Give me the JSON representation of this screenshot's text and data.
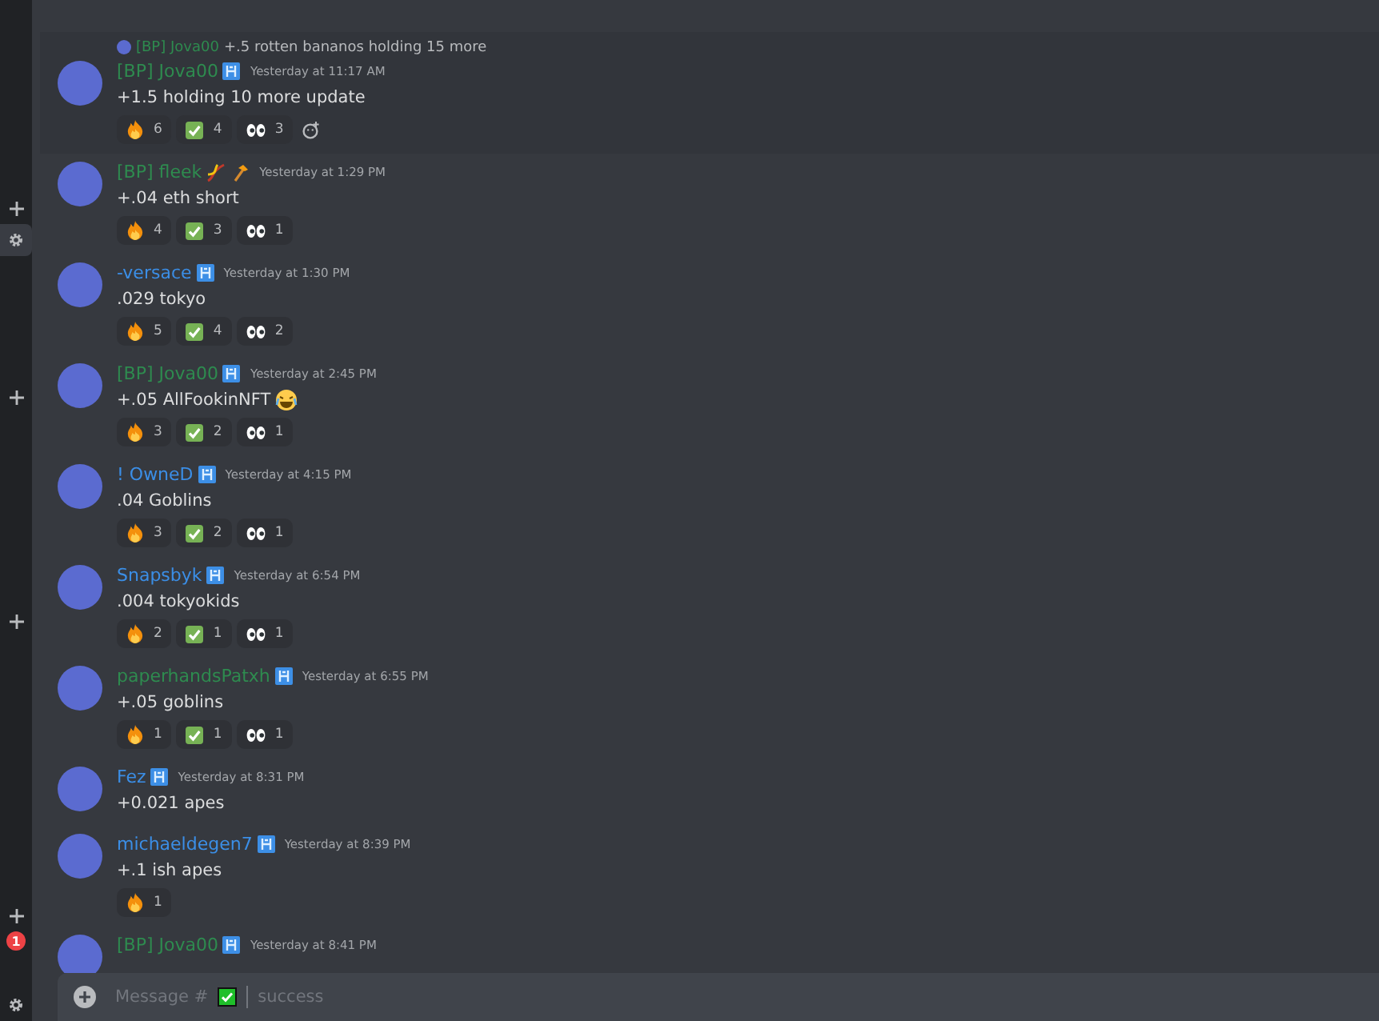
{
  "sidebar": {
    "items": [
      {
        "kind": "plus"
      },
      {
        "kind": "gear",
        "selected": true
      },
      {
        "kind": "plus"
      },
      {
        "kind": "plus"
      },
      {
        "kind": "plus"
      },
      {
        "kind": "badge",
        "count": "1"
      },
      {
        "kind": "gear",
        "selected": false
      }
    ]
  },
  "messages": [
    {
      "hovered": true,
      "reply": {
        "author": "[BP] Jova00",
        "color": "#2e8b4f",
        "text": "+.5 rotten bananos holding 15 more"
      },
      "author": "[BP] Jova00",
      "color": "#2e8b4f",
      "role_badge": true,
      "time": "Yesterday at 11:17 AM",
      "text": "+1.5 holding 10 more update",
      "reactions": [
        {
          "kind": "fire",
          "count": "6"
        },
        {
          "kind": "check",
          "count": "4"
        },
        {
          "kind": "eyes",
          "count": "3"
        }
      ]
    },
    {
      "hovered": false,
      "author": "[BP] fleek",
      "color": "#2e8b4f",
      "role_badge": false,
      "name_emojis": true,
      "time": "Yesterday at 1:29 PM",
      "text": "+.04 eth short",
      "reactions": [
        {
          "kind": "fire",
          "count": "4"
        },
        {
          "kind": "check",
          "count": "3"
        },
        {
          "kind": "eyes",
          "count": "1"
        }
      ]
    },
    {
      "hovered": false,
      "author": "-versace",
      "color": "#3b8ee6",
      "role_badge": true,
      "time": "Yesterday at 1:30 PM",
      "text": ".029 tokyo",
      "reactions": [
        {
          "kind": "fire",
          "count": "5"
        },
        {
          "kind": "check",
          "count": "4"
        },
        {
          "kind": "eyes",
          "count": "2"
        }
      ]
    },
    {
      "hovered": false,
      "author": "[BP] Jova00",
      "color": "#2e8b4f",
      "role_badge": true,
      "time": "Yesterday at 2:45 PM",
      "text": "+.05 AllFookinNFT",
      "text_emoji": true,
      "reactions": [
        {
          "kind": "fire",
          "count": "3"
        },
        {
          "kind": "check",
          "count": "2"
        },
        {
          "kind": "eyes",
          "count": "1"
        }
      ]
    },
    {
      "hovered": false,
      "author": "! OwneD",
      "color": "#3b8ee6",
      "role_badge": true,
      "time": "Yesterday at 4:15 PM",
      "text": ".04 Goblins",
      "reactions": [
        {
          "kind": "fire",
          "count": "3"
        },
        {
          "kind": "check",
          "count": "2"
        },
        {
          "kind": "eyes",
          "count": "1"
        }
      ]
    },
    {
      "hovered": false,
      "author": "Snapsbyk",
      "color": "#3b8ee6",
      "role_badge": true,
      "time": "Yesterday at 6:54 PM",
      "text": ".004 tokyokids",
      "reactions": [
        {
          "kind": "fire",
          "count": "2"
        },
        {
          "kind": "check",
          "count": "1"
        },
        {
          "kind": "eyes",
          "count": "1"
        }
      ]
    },
    {
      "hovered": false,
      "author": "paperhandsPatxh",
      "color": "#2e8b4f",
      "role_badge": true,
      "time": "Yesterday at 6:55 PM",
      "text": "+.05 goblins",
      "reactions": [
        {
          "kind": "fire",
          "count": "1"
        },
        {
          "kind": "check",
          "count": "1"
        },
        {
          "kind": "eyes",
          "count": "1"
        }
      ]
    },
    {
      "hovered": false,
      "author": "Fez",
      "color": "#3b8ee6",
      "role_badge": true,
      "time": "Yesterday at 8:31 PM",
      "text": "+0.021 apes"
    },
    {
      "hovered": false,
      "author": "michaeldegen7",
      "color": "#3b8ee6",
      "role_badge": true,
      "time": "Yesterday at 8:39 PM",
      "text": "+.1 ish apes",
      "reactions": [
        {
          "kind": "fire",
          "count": "1"
        }
      ]
    },
    {
      "hovered": false,
      "author": "[BP] Jova00",
      "color": "#2e8b4f",
      "role_badge": true,
      "time": "Yesterday at 8:41 PM"
    }
  ],
  "composer": {
    "placeholder_start": "Message #",
    "placeholder_end": "success"
  }
}
